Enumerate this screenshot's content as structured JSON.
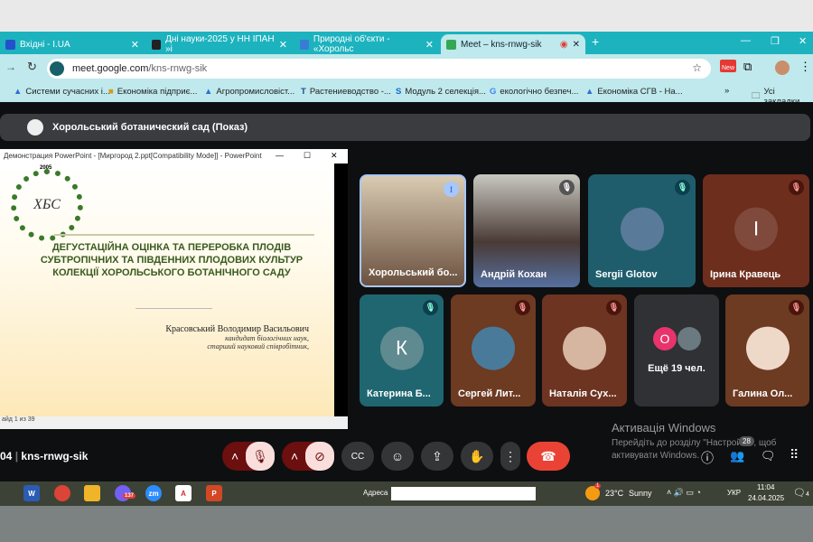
{
  "browser": {
    "tabs": [
      {
        "label": "Вхідні - I.UA"
      },
      {
        "label": "Дні науки-2025 у НН ІПАН »і"
      },
      {
        "label": "Природні об'єкти - «Хорольс"
      },
      {
        "label": "Meet – kns-rnwg-sik",
        "active": true
      }
    ],
    "url_domain": "meet.google.com",
    "url_path": "/kns-rnwg-sik",
    "bookmarks": [
      "Системи сучасних і...",
      "Економіка підприє...",
      "Агропромисловіст...",
      "Растениеводство -...",
      "Модуль 2 селекція...",
      "екологічно безпеч...",
      "Економіка СГВ - На..."
    ],
    "all_bookmarks": "Усі закладки",
    "new_badge": "New"
  },
  "meet": {
    "presenting": "Хорольський ботанический сад (Показ)",
    "ppt": {
      "window_title": "Демонстрация PowerPoint - [Миргород 2.ppt[Compatibility Mode]] - PowerPoint",
      "logo_year": "2005",
      "logo_letters": "ХБС",
      "slide_title": "ДЕГУСТАЦІЙНА ОЦІНКА ТА ПЕРЕРОБКА ПЛОДІВ СУБТРОПІЧНИХ ТА ПІВДЕННИХ ПЛОДОВИХ КУЛЬТУР КОЛЕКЦІЇ ХОРОЛЬСЬКОГО БОТАНІЧНОГО САДУ",
      "author": "Красовський Володимир Васильович",
      "degree": "кандидат біологічних наук,",
      "position": "старший науковий співробітник,",
      "status": "айд 1 из 39"
    },
    "participants": [
      {
        "name": "Хорольський бо...",
        "speaking": true
      },
      {
        "name": "Андрій Кохан",
        "muted": true
      },
      {
        "name": "Sergii Glotov",
        "muted": true
      },
      {
        "name": "Ірина Кравець",
        "initial": "І",
        "muted": true
      },
      {
        "name": "Катерина Б...",
        "initial": "К",
        "muted": true
      },
      {
        "name": "Сергей Лит...",
        "muted": true
      },
      {
        "name": "Наталія Сух...",
        "muted": true
      },
      {
        "name": "Галина Ол...",
        "muted": true
      }
    ],
    "more": {
      "label": "Ещё 19 чел.",
      "initial": "О"
    },
    "time": "04",
    "code": "kns-rnwg-sik",
    "people_count": "28",
    "activation_title": "Активація Windows",
    "activation_text1": "Перейдіть до розділу \"Настройки\", щоб",
    "activation_text2": "активувати Windows."
  },
  "taskbar": {
    "address_label": "Адреса",
    "viber_badge": "137",
    "weather_badge": "1",
    "temp": "23°C",
    "weather": "Sunny",
    "lang": "УКР",
    "time": "11:04",
    "date": "24.04.2025",
    "notif": "4"
  },
  "colors": {
    "tab_teal": "#1cb3bf",
    "end_call": "#ea4335",
    "muted_red": "#6b0f0f"
  }
}
